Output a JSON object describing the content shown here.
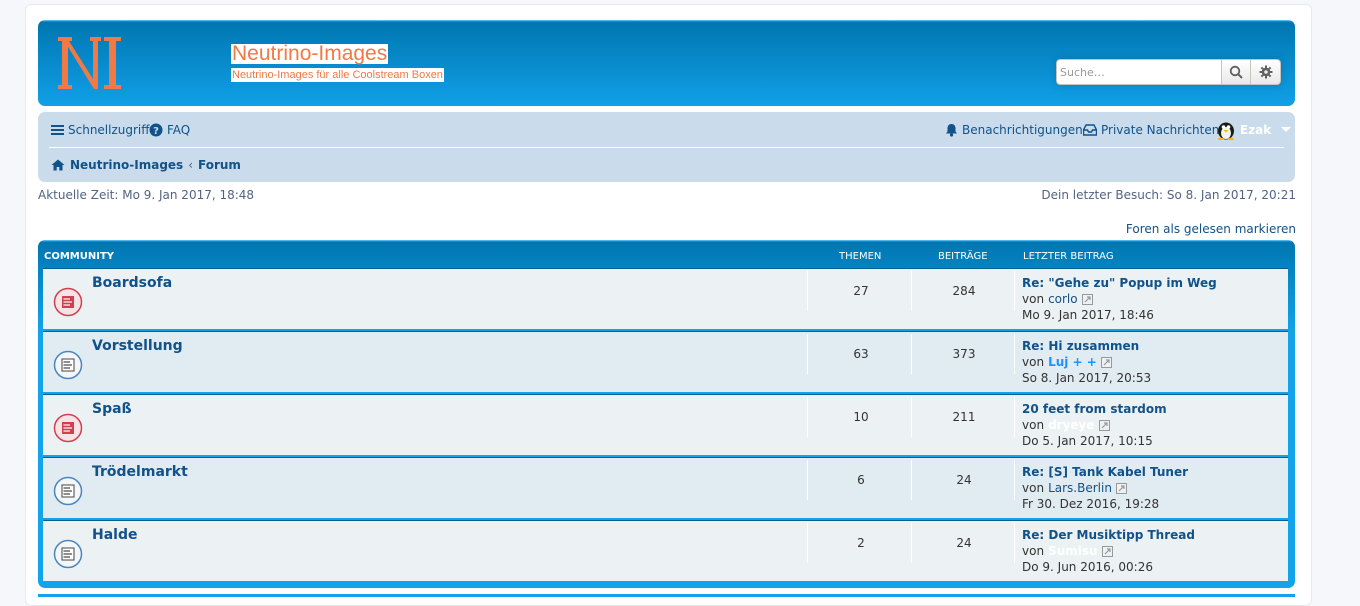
{
  "header": {
    "logo_icon": "ni-logo",
    "site_title": "Neutrino-Images",
    "site_description": "Neutrino-Images für alle Coolstream Boxen",
    "search": {
      "placeholder": "Suche…",
      "value": ""
    }
  },
  "nav": {
    "quicklinks_label": "Schnellzugriff",
    "faq_label": "FAQ",
    "notifications_label": "Benachrichtigungen",
    "pm_label": "Private Nachrichten",
    "user_name": "Ezak",
    "breadcrumbs": [
      "Neutrino-Images",
      "Forum"
    ]
  },
  "info": {
    "current_time": "Aktuelle Zeit: Mo 9. Jan 2017, 18:48",
    "last_visit": "Dein letzter Besuch: So 8. Jan 2017, 20:21",
    "mark_read": "Foren als gelesen markieren"
  },
  "forum_table": {
    "headers": {
      "category": "COMMUNITY",
      "topics": "THEMEN",
      "posts": "BEITRÄGE",
      "last_post": "LETZTER BEITRAG"
    },
    "rows": [
      {
        "title": "Boardsofa",
        "topics": "27",
        "posts": "284",
        "last_title": "Re: \"Gehe zu\" Popup im Weg",
        "by": "von",
        "author": "corlo",
        "time": "Mo 9. Jan 2017, 18:46",
        "unread": true
      },
      {
        "title": "Vorstellung",
        "topics": "63",
        "posts": "373",
        "last_title": "Re: Hi zusammen",
        "by": "von",
        "author": "Luj + +",
        "time": "So 8. Jan 2017, 20:53",
        "unread": false
      },
      {
        "title": "Spaß",
        "topics": "10",
        "posts": "211",
        "last_title": "20 feet from stardom",
        "by": "von",
        "author": "dryeye",
        "time": "Do 5. Jan 2017, 10:15",
        "unread": true
      },
      {
        "title": "Trödelmarkt",
        "topics": "6",
        "posts": "24",
        "last_title": "Re: [S] Tank Kabel Tuner",
        "by": "von",
        "author": "Lars.Berlin",
        "time": "Fr 30. Dez 2016, 19:28",
        "unread": false
      },
      {
        "title": "Halde",
        "topics": "2",
        "posts": "24",
        "last_title": "Re: Der Musiktipp Thread",
        "by": "von",
        "author": "Sumisu",
        "time": "Do 9. Jun 2016, 00:26",
        "unread": false
      }
    ]
  },
  "colors": {
    "accent": "#12a3eb",
    "link": "#105289",
    "logo": "#f07946",
    "unread_icon": "#d1404f",
    "read_icon": "#4b85c0"
  }
}
